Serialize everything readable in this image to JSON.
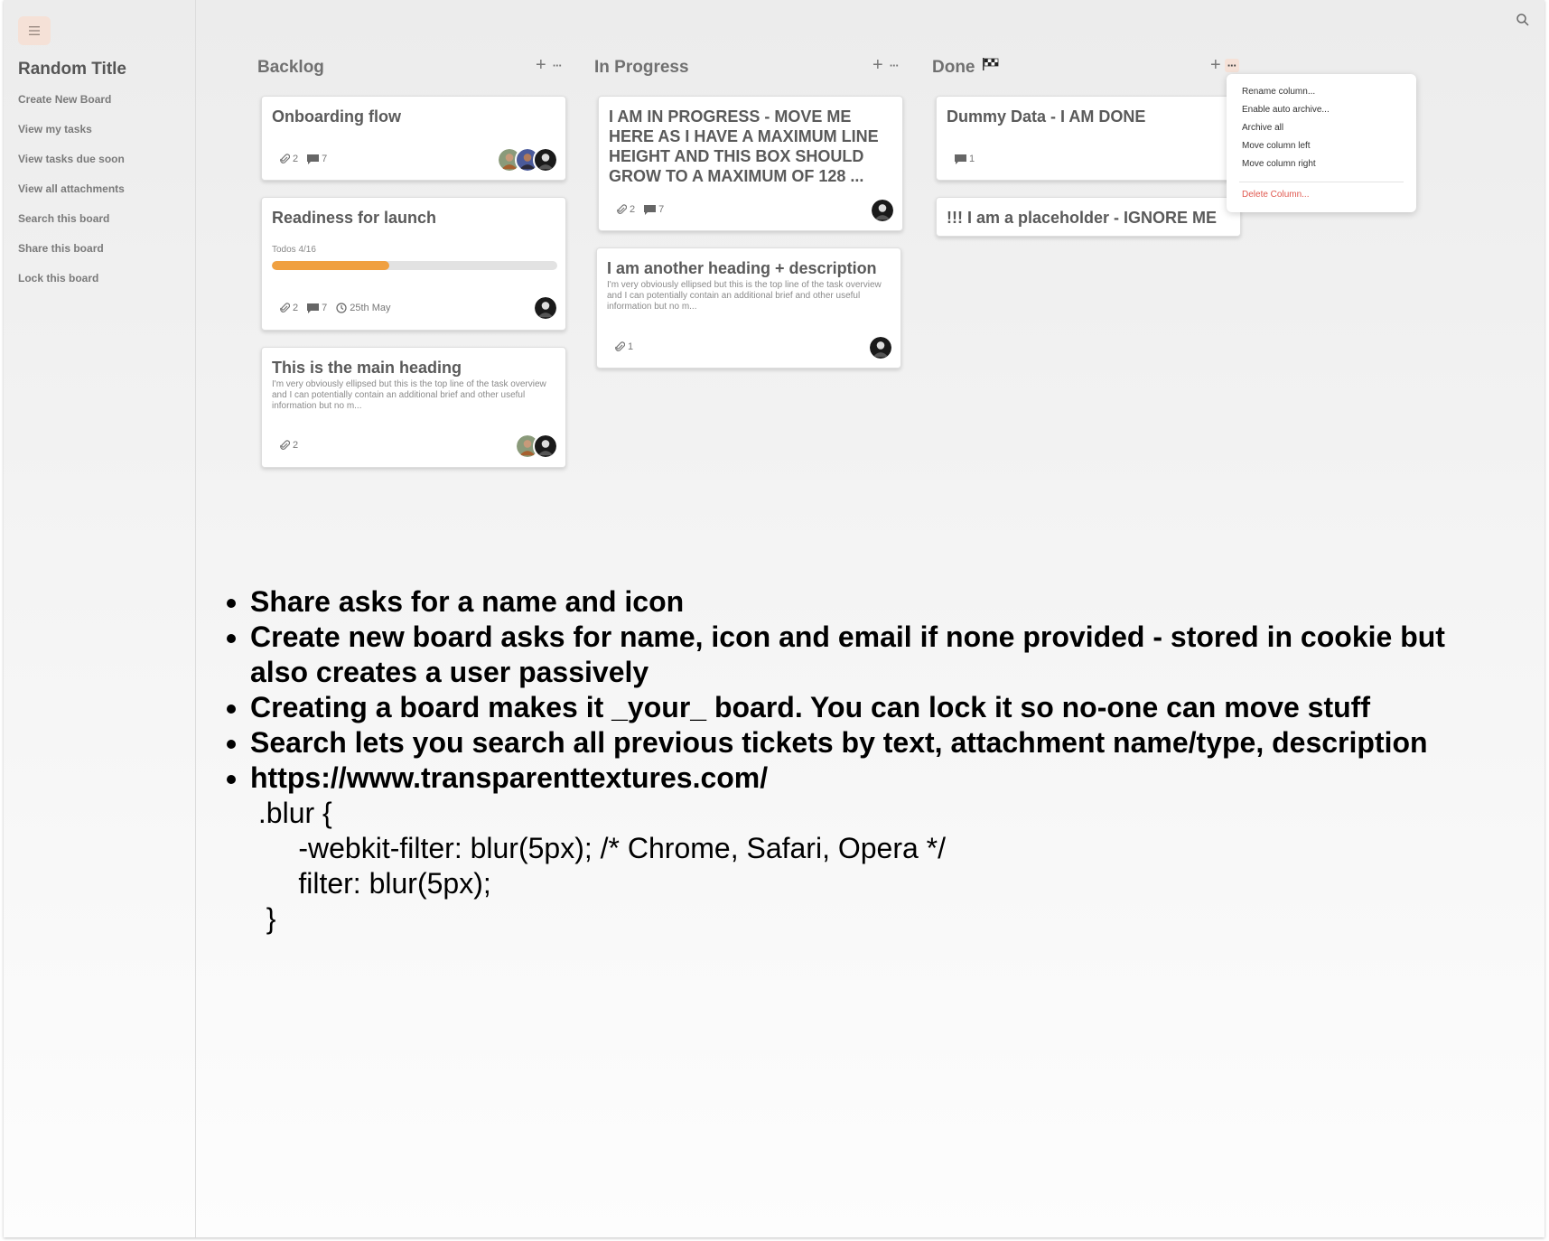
{
  "sidebar": {
    "board_title": "Random Title",
    "items": [
      {
        "label": "Create New Board"
      },
      {
        "label": "View my tasks"
      },
      {
        "label": "View tasks due soon"
      },
      {
        "label": "View all attachments"
      },
      {
        "label": "Search this board"
      },
      {
        "label": "Share this board"
      },
      {
        "label": "Lock this board"
      }
    ]
  },
  "columns": [
    {
      "title": "Backlog",
      "add_label": "+",
      "more_label": "···",
      "cards": [
        {
          "title": "Onboarding flow",
          "attachments": "2",
          "comments": "7"
        },
        {
          "title": "Readiness for launch",
          "todos_label": "Todos 4/16",
          "progress": 0.41,
          "attachments": "2",
          "comments": "7",
          "due": "25th May"
        },
        {
          "title": "This is the main heading",
          "description": "I'm very obviously ellipsed but this is the top line of the task overview and I can potentially contain an additional brief and other useful information but no m...",
          "attachments": "2"
        }
      ]
    },
    {
      "title": "In Progress",
      "add_label": "+",
      "more_label": "···",
      "cards": [
        {
          "title": "I AM IN PROGRESS - MOVE ME HERE AS I HAVE A MAXIMUM LINE HEIGHT AND THIS BOX SHOULD GROW TO A MAXIMUM OF 128 ...",
          "attachments": "2",
          "comments": "7"
        },
        {
          "title": "I am another heading + description",
          "description": "I'm very obviously ellipsed but this is the top line of the task overview and I can potentially contain an additional brief and other useful information but no m...",
          "attachments": "1"
        }
      ]
    },
    {
      "title": "Done",
      "title_icon": "checkered-flag-icon",
      "add_label": "+",
      "more_label": "···",
      "cards": [
        {
          "title": "Dummy Data - I AM DONE",
          "comments": "1"
        },
        {
          "title": "!!! I am a placeholder - IGNORE ME"
        }
      ]
    }
  ],
  "column_menu": {
    "items": [
      "Rename column...",
      "Enable auto archive...",
      "Archive all",
      "Move column left",
      "Move column right"
    ],
    "danger_item": "Delete Column..."
  },
  "notes": {
    "bullets": [
      "Share asks for a name and icon",
      "Create new board asks for name, icon and email if none provided - stored in cookie but also creates a user passively",
      "Creating a board makes it _your_ board. You can lock it so no-one can move stuff",
      "Search lets you search all previous tickets by text, attachment name/type, description",
      "https://www.transparenttextures.com/"
    ],
    "code": [
      " .blur {",
      "      -webkit-filter: blur(5px); /* Chrome, Safari, Opera */",
      "      filter: blur(5px);",
      "  }"
    ]
  },
  "colors": {
    "accent": "#f0a040",
    "menu_button_bg": "#f5e1d7",
    "danger": "#e0584f"
  }
}
